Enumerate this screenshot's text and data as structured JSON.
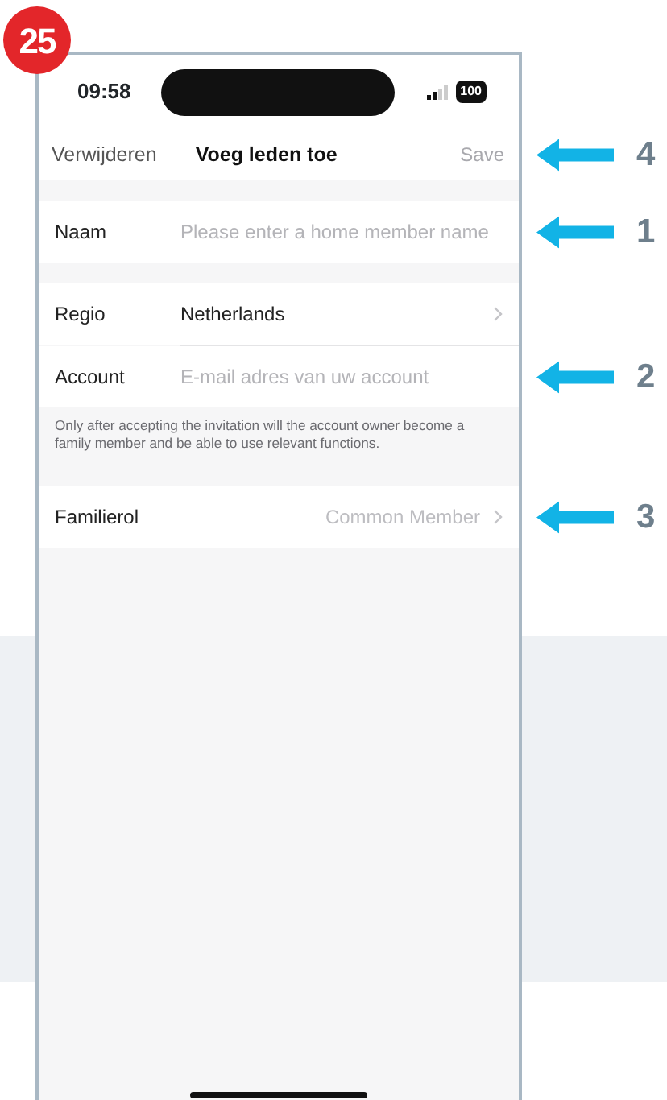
{
  "badge": "25",
  "status_bar": {
    "time": "09:58",
    "battery": "100"
  },
  "nav": {
    "left": "Verwijderen",
    "title": "Voeg leden toe",
    "right": "Save",
    "right_disabled": true,
    "callout": "4"
  },
  "form_groups": [
    {
      "rows": [
        {
          "kind": "input",
          "label": "Naam",
          "placeholder": "Please enter a home member name",
          "callout": "1"
        }
      ]
    },
    {
      "rows": [
        {
          "kind": "select",
          "label": "Regio",
          "value": "Netherlands",
          "dimmed": false
        },
        {
          "kind": "input",
          "label": "Account",
          "placeholder": "E-mail adres van uw account",
          "callout": "2"
        }
      ],
      "note": "Only after accepting the invitation will the account owner become a family member and be able to use relevant functions."
    },
    {
      "rows": [
        {
          "kind": "select",
          "label": "Familierol",
          "value": "Common Member",
          "dimmed": true,
          "callout": "3"
        }
      ]
    }
  ]
}
